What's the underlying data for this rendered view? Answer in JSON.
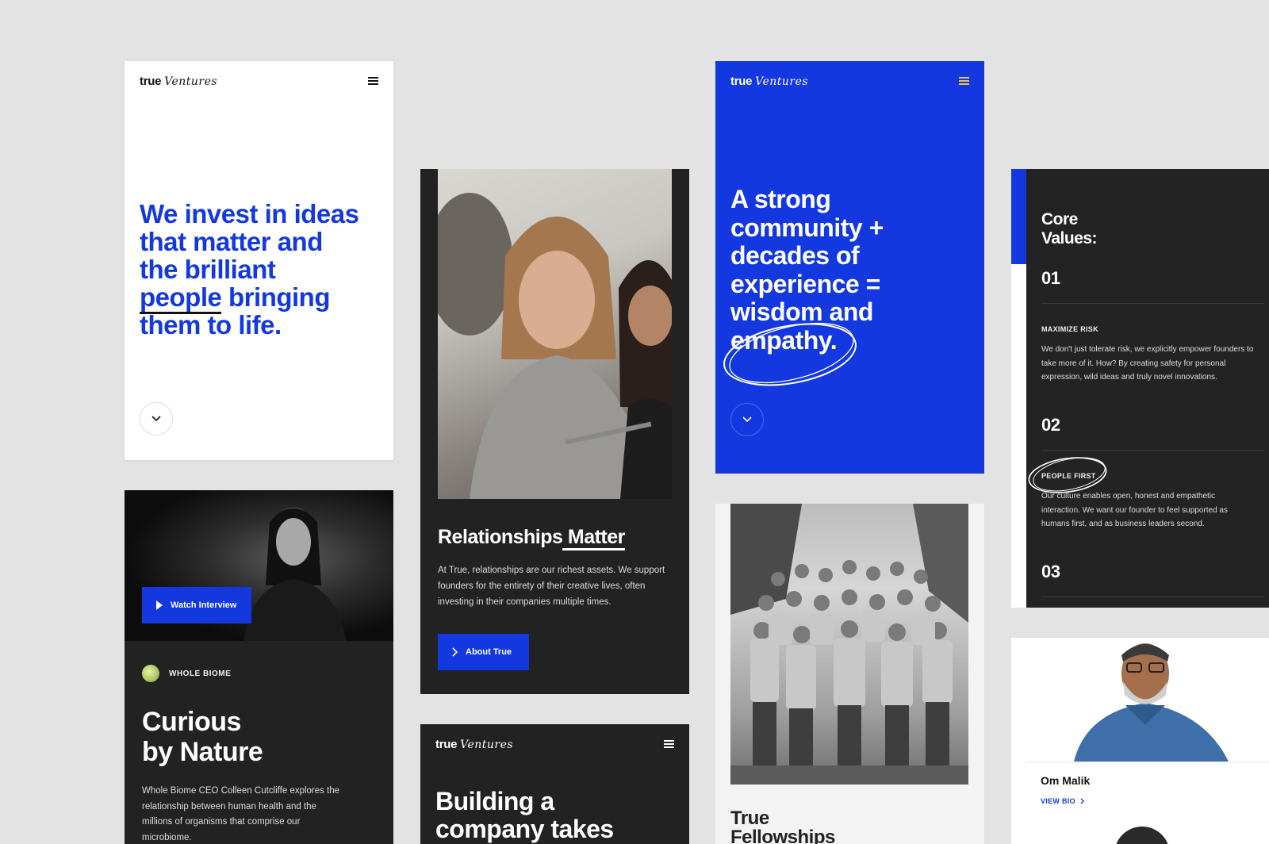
{
  "card1": {
    "logo_true": "true",
    "logo_script": "Ventures",
    "headline_lines": [
      "We invest in ideas",
      "that matter and",
      "the brilliant"
    ],
    "headline_underlined": "people",
    "headline_rest": " bringing",
    "headline_last": "them to life.",
    "scroll_icon": "chevron-down-icon"
  },
  "card2": {
    "watch_label": "Watch Interview",
    "company_label": "WHOLE BIOME",
    "title_line1": "Curious",
    "title_line2": "by Nature",
    "body": "Whole Biome CEO Colleen Cutcliffe explores the relationship between human health and the millions of organisms that comprise our microbiome."
  },
  "card3": {
    "title_a": "Relationships",
    "title_b": " Matter",
    "body": "At True, relationships are our richest assets. We support founders for the entirety of their creative lives, often investing in their companies multiple times.",
    "button_label": "About True"
  },
  "card4": {
    "logo_true": "true",
    "logo_script": "Ventures",
    "headline_line1": "Building a",
    "headline_line2": "company takes"
  },
  "card5": {
    "logo_true": "true",
    "logo_script": "Ventures",
    "headline_lines": [
      "A strong",
      "community +",
      "decades of",
      "experience =",
      "wisdom and",
      "empathy."
    ]
  },
  "card6": {
    "title_line1": "True",
    "title_line2": "Fellowships"
  },
  "card7": {
    "title_line1": "Core",
    "title_line2": "Values:",
    "values": [
      {
        "num": "01",
        "label": "MAXIMIZE RISK",
        "body": "We don't just tolerate risk, we explicitly empower founders to take more of it. How? By creating safety for personal expression, wild ideas and truly novel innovations."
      },
      {
        "num": "02",
        "label": "PEOPLE FIRST",
        "body": "Our culture enables open, honest and empathetic interaction. We want our founder to feel supported as humans first, and as business leaders second."
      },
      {
        "num": "03",
        "label": "",
        "body": ""
      }
    ]
  },
  "card8": {
    "name": "Om Malik",
    "link_label": "VIEW BIO"
  },
  "colors": {
    "brand_blue": "#1338e0",
    "dark": "#222222",
    "background": "#e3e3e3"
  }
}
